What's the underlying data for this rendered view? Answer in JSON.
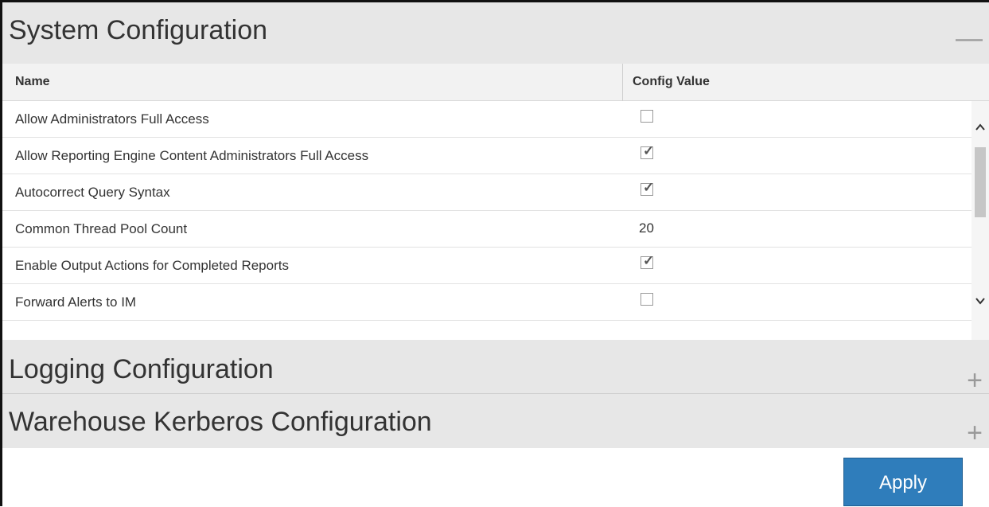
{
  "sections": {
    "system": {
      "title": "System Configuration",
      "toggle_glyph": "—",
      "expanded": true
    },
    "logging": {
      "title": "Logging Configuration",
      "toggle_glyph": "+",
      "expanded": false
    },
    "warehouse": {
      "title": "Warehouse Kerberos Configuration",
      "toggle_glyph": "+",
      "expanded": false
    }
  },
  "table": {
    "columns": [
      "Name",
      "Config Value"
    ],
    "rows": [
      {
        "name": "Allow Administrators Full Access",
        "type": "checkbox",
        "checked": false
      },
      {
        "name": "Allow Reporting Engine Content Administrators Full Access",
        "type": "checkbox",
        "checked": true
      },
      {
        "name": "Autocorrect Query Syntax",
        "type": "checkbox",
        "checked": true
      },
      {
        "name": "Common Thread Pool Count",
        "type": "text",
        "value": "20"
      },
      {
        "name": "Enable Output Actions for Completed Reports",
        "type": "checkbox",
        "checked": true
      },
      {
        "name": "Forward Alerts to IM",
        "type": "checkbox",
        "checked": false
      }
    ]
  },
  "apply_label": "Apply",
  "icons": {
    "scroll_up": "chevron-up-icon",
    "scroll_down": "chevron-down-icon",
    "check": "checkmark-icon"
  },
  "colors": {
    "header_bg": "#e7e7e7",
    "accent": "#2f7dbb"
  }
}
